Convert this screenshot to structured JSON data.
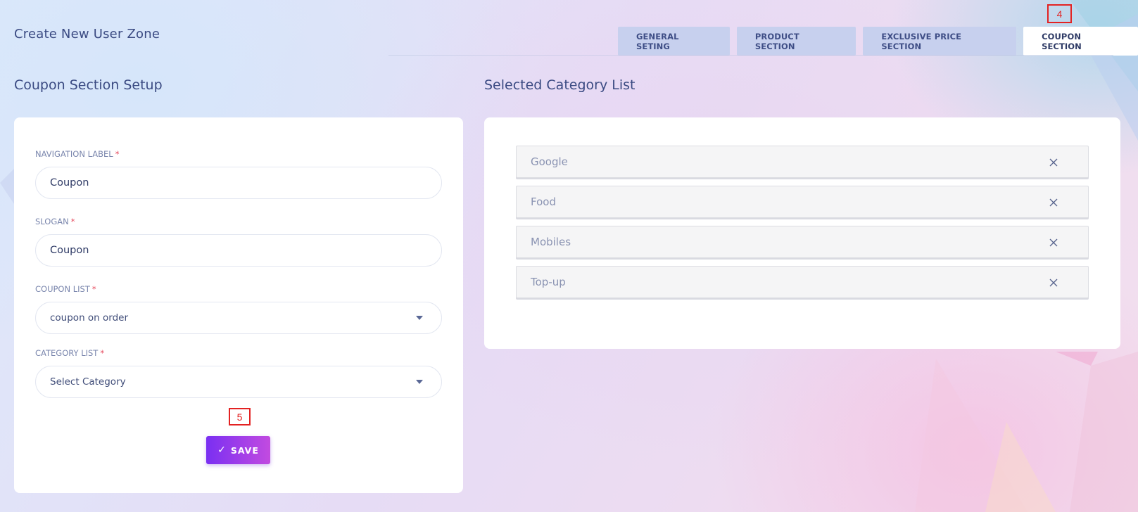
{
  "page": {
    "title": "Create New User Zone"
  },
  "tabs": [
    {
      "label": "GENERAL SETING",
      "active": false
    },
    {
      "label": "PRODUCT SECTION",
      "active": false
    },
    {
      "label": "EXCLUSIVE PRICE SECTION",
      "active": false
    },
    {
      "label": "COUPON SECTION",
      "active": true
    }
  ],
  "markers": {
    "tab": "4",
    "save": "5"
  },
  "form": {
    "title": "Coupon Section Setup",
    "navigation_label": {
      "label": "NAVIGATION LABEL",
      "required": "*",
      "value": "Coupon"
    },
    "slogan": {
      "label": "SLOGAN",
      "required": "*",
      "value": "Coupon"
    },
    "coupon_list": {
      "label": "COUPON LIST",
      "required": "*",
      "selected": "coupon on order"
    },
    "category_list": {
      "label": "CATEGORY LIST",
      "required": "*",
      "selected": "Select Category"
    },
    "save_label": "SAVE",
    "save_icon": "check-icon"
  },
  "selected": {
    "title": "Selected Category List",
    "items": [
      {
        "label": "Google",
        "icon": "close-icon"
      },
      {
        "label": "Food",
        "icon": "close-icon"
      },
      {
        "label": "Mobiles",
        "icon": "close-icon"
      },
      {
        "label": "Top-up",
        "icon": "close-icon"
      }
    ]
  },
  "colors": {
    "accent_gradient_start": "#7a2ff2",
    "accent_gradient_end": "#c24be0",
    "tab_inactive": "#c7d0ee",
    "tab_active": "#ffffff",
    "marker": "#e32222",
    "required": "#e64a5d"
  }
}
